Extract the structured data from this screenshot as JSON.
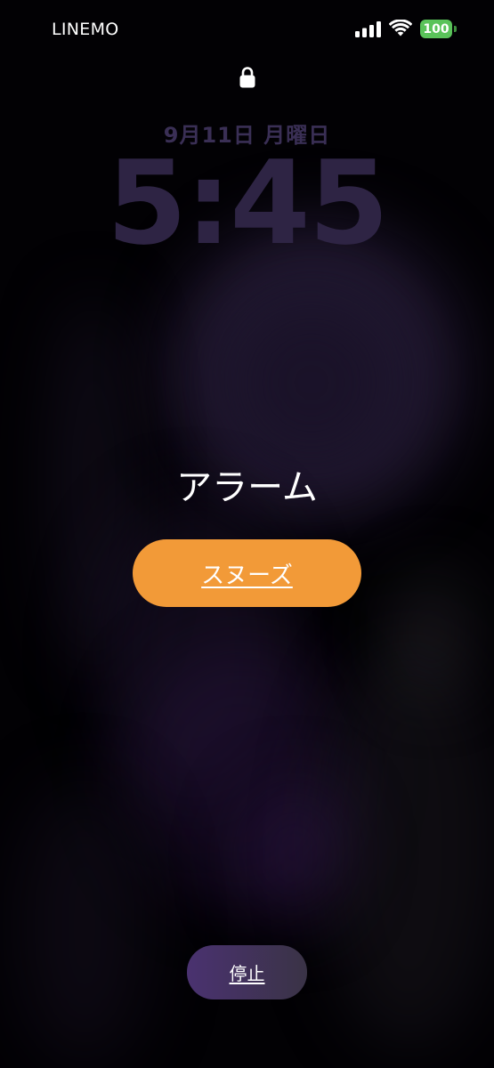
{
  "status_bar": {
    "carrier": "LINEMO",
    "battery_level": "100",
    "signal_icon": "cellular-signal-icon",
    "wifi_icon": "wifi-icon",
    "battery_color": "#5ac35a"
  },
  "lock_screen": {
    "lock_icon": "lock-icon",
    "date": "9月11日 月曜日",
    "time": "5:45"
  },
  "alarm": {
    "label": "アラーム",
    "snooze_label": "スヌーズ",
    "stop_label": "停止",
    "snooze_color": "#f29a38"
  }
}
